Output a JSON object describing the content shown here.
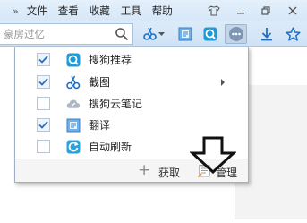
{
  "menubar": {
    "items": [
      "文件",
      "查看",
      "收藏",
      "工具",
      "帮助"
    ],
    "overflow": "»"
  },
  "search": {
    "value": "豪房过亿"
  },
  "menu": {
    "items": [
      {
        "label": "搜狗推荐",
        "checked": true,
        "icon": "sogou-recommend-icon",
        "submenu": false
      },
      {
        "label": "截图",
        "checked": true,
        "icon": "scissors-icon",
        "submenu": true
      },
      {
        "label": "搜狗云笔记",
        "checked": false,
        "icon": "cloud-note-icon",
        "submenu": false
      },
      {
        "label": "翻译",
        "checked": true,
        "icon": "translate-icon",
        "submenu": false
      },
      {
        "label": "自动刷新",
        "checked": false,
        "icon": "auto-refresh-icon",
        "submenu": false
      }
    ],
    "footer": {
      "get_label": "获取",
      "manage_label": "管理"
    }
  },
  "colors": {
    "accent": "#1f8fe0",
    "checkmark": "#2a6ebd",
    "menubar_bg": "#d6e7f8"
  }
}
